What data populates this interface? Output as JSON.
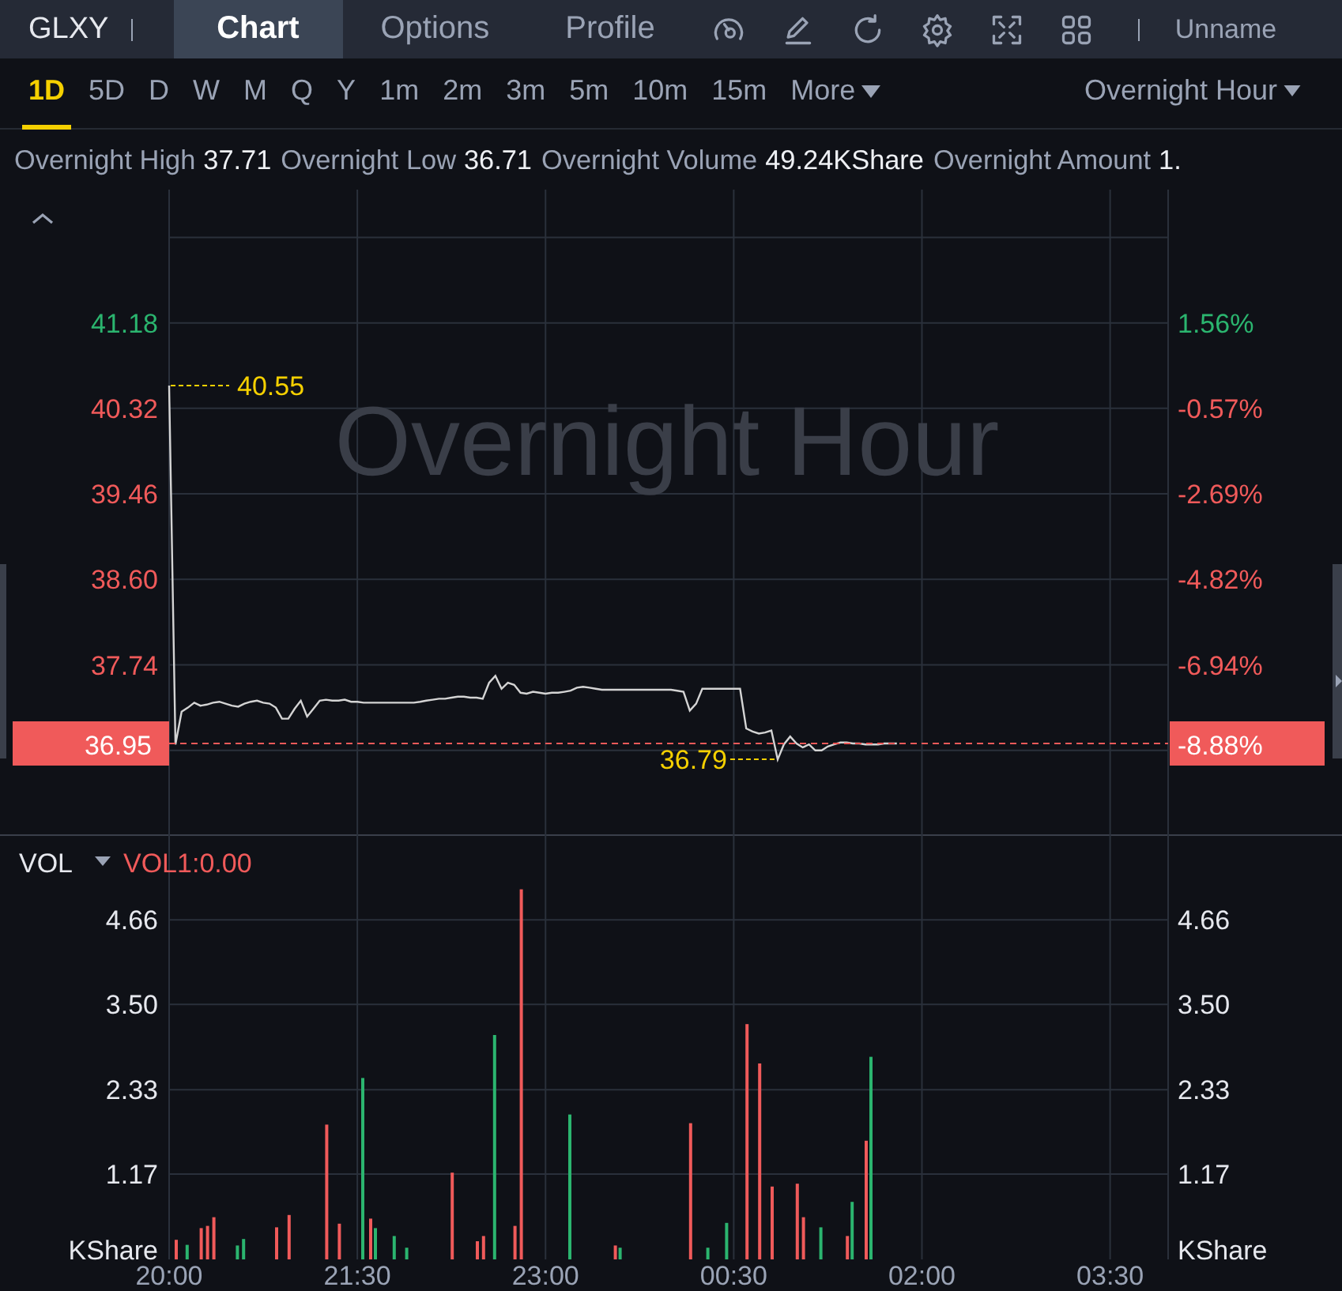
{
  "header": {
    "symbol": "GLXY",
    "tabs": [
      {
        "label": "Chart",
        "selected": true
      },
      {
        "label": "Options",
        "selected": false
      },
      {
        "label": "Profile",
        "selected": false
      }
    ],
    "user": "Unname"
  },
  "periods": {
    "items": [
      {
        "label": "1D",
        "selected": true,
        "kind": "period"
      },
      {
        "label": "5D",
        "selected": false,
        "kind": "period"
      },
      {
        "label": "D",
        "selected": false,
        "kind": "period"
      },
      {
        "label": "W",
        "selected": false,
        "kind": "period"
      },
      {
        "label": "M",
        "selected": false,
        "kind": "period"
      },
      {
        "label": "Q",
        "selected": false,
        "kind": "period"
      },
      {
        "label": "Y",
        "selected": false,
        "kind": "period"
      },
      {
        "label": "1m",
        "selected": false,
        "kind": "period"
      },
      {
        "label": "2m",
        "selected": false,
        "kind": "period"
      },
      {
        "label": "3m",
        "selected": false,
        "kind": "period"
      },
      {
        "label": "5m",
        "selected": false,
        "kind": "period"
      },
      {
        "label": "10m",
        "selected": false,
        "kind": "period"
      },
      {
        "label": "15m",
        "selected": false,
        "kind": "period"
      },
      {
        "label": "More",
        "selected": false,
        "kind": "dropdown"
      }
    ],
    "session": "Overnight Hour"
  },
  "stats": [
    {
      "label": "Overnight High",
      "value": "37.71"
    },
    {
      "label": "Overnight Low",
      "value": "36.71"
    },
    {
      "label": "Overnight Volume",
      "value": "49.24KShare"
    },
    {
      "label": "Overnight Amount",
      "value": "1."
    }
  ],
  "price_panel": {
    "background_label": "Overnight Hour",
    "axis_rows": [
      {
        "color": "#2bb56f",
        "right_label": "1.56%"
      },
      {
        "color": "#f05a5a",
        "right_label": "-0.57%"
      },
      {
        "color": "#f05a5a",
        "right_label": "-2.69%"
      },
      {
        "color": "#f05a5a",
        "right_label": "-4.82%"
      },
      {
        "color": "#f05a5a",
        "right_label": "-6.94%"
      }
    ],
    "last_price": {
      "change": "-8.88%"
    },
    "chart_data": {
      "type": "line",
      "series": [
        {
          "color": "#d4d4d4",
          "values": [
            40.55,
            36.94,
            37.27,
            37.31,
            37.36,
            37.33,
            37.34,
            37.36,
            37.37,
            37.35,
            37.33,
            37.32,
            37.35,
            37.37,
            37.38,
            37.36,
            37.35,
            37.31,
            37.2,
            37.2,
            37.3,
            37.38,
            37.22,
            37.3,
            37.38,
            37.39,
            37.38,
            37.38,
            37.39,
            37.37,
            37.37,
            37.36,
            37.36,
            37.36,
            37.36,
            37.36,
            37.36,
            37.36,
            37.36,
            37.36,
            37.37,
            37.38,
            37.39,
            37.4,
            37.4,
            37.41,
            37.42,
            37.42,
            37.41,
            37.41,
            37.4,
            37.56,
            37.63,
            37.5,
            37.56,
            37.54,
            37.46,
            37.45,
            37.47,
            37.46,
            37.45,
            37.46,
            37.46,
            37.47,
            37.48,
            37.51,
            37.52,
            37.51,
            37.5,
            37.49,
            37.49,
            37.49,
            37.49,
            37.49,
            37.49,
            37.49,
            37.49,
            37.49,
            37.49,
            37.49,
            37.49,
            37.48,
            37.47,
            37.28,
            37.35,
            37.5,
            37.5,
            37.5,
            37.5,
            37.5,
            37.5,
            37.5,
            37.1,
            37.07,
            37.05,
            37.06,
            37.08,
            36.79,
            36.94,
            37.02,
            36.95,
            36.91,
            36.94,
            36.88,
            36.88,
            36.92,
            36.94,
            36.96,
            36.96,
            36.95,
            36.95,
            36.94,
            36.94,
            36.94,
            36.95,
            36.95,
            36.95,
            null,
            null,
            null,
            null,
            null,
            null,
            null,
            null,
            null,
            null,
            null,
            null,
            null,
            null,
            null,
            null,
            null,
            null,
            null,
            null,
            null,
            null,
            null,
            null,
            null,
            null,
            null,
            null,
            null,
            null,
            null,
            null,
            null,
            null,
            null,
            null,
            null,
            null,
            null,
            null,
            null,
            null,
            null
          ]
        }
      ],
      "ylim": [
        36.036,
        42.52
      ],
      "grid": true,
      "ref_lines": [
        {
          "axis": "y",
          "value": 36.95,
          "label": "36.95",
          "color": "#f05a5a"
        }
      ],
      "yticks": [
        {
          "value": 41.18,
          "label": "41.18"
        },
        {
          "value": 40.32,
          "label": "40.32"
        },
        {
          "value": 39.46,
          "label": "39.46"
        },
        {
          "value": 38.6,
          "label": "38.60"
        },
        {
          "value": 37.74,
          "label": "37.74"
        }
      ],
      "annotations": [
        "40.55",
        "36.79"
      ]
    }
  },
  "volume_panel": {
    "indicator": "VOL",
    "indicator_value": "VOL1:0.00",
    "right_yticks": [
      "4.66",
      "3.50",
      "2.33",
      "1.17"
    ],
    "ylabel_right": "KShare",
    "chart_data": {
      "type": "bar",
      "ylabel": "KShare",
      "categories": [
        "20:00",
        null,
        null,
        null,
        null,
        null,
        null,
        null,
        null,
        null,
        null,
        null,
        null,
        null,
        null,
        null,
        null,
        null,
        null,
        null,
        null,
        null,
        null,
        null,
        null,
        null,
        null,
        null,
        null,
        null,
        "21:30",
        null,
        null,
        null,
        null,
        null,
        null,
        null,
        null,
        null,
        null,
        null,
        null,
        null,
        null,
        null,
        null,
        null,
        null,
        null,
        null,
        null,
        null,
        null,
        null,
        null,
        null,
        null,
        null,
        null,
        "23:00",
        null,
        null,
        null,
        null,
        null,
        null,
        null,
        null,
        null,
        null,
        null,
        null,
        null,
        null,
        null,
        null,
        null,
        null,
        null,
        null,
        null,
        null,
        null,
        null,
        null,
        null,
        null,
        null,
        null,
        "00:30",
        null,
        null,
        null,
        null,
        null,
        null,
        null,
        null,
        null,
        null,
        null,
        null,
        null,
        null,
        null,
        null,
        null,
        null,
        null,
        null,
        null,
        null,
        null,
        null,
        null,
        null,
        null,
        null,
        null,
        "02:00",
        null,
        null,
        null,
        null,
        null,
        null,
        null,
        null,
        null,
        null,
        null,
        null,
        null,
        null,
        null,
        null,
        null,
        null,
        null,
        null,
        null,
        null,
        null,
        null,
        null,
        null,
        null,
        null,
        null,
        "03:30",
        null,
        null,
        null,
        null,
        null,
        null,
        null,
        null,
        null
      ],
      "series": [
        {
          "color": "#2bb56f",
          "values": [
            null,
            null,
            null,
            0.2,
            null,
            null,
            null,
            null,
            null,
            null,
            null,
            0.19,
            0.28,
            null,
            null,
            null,
            null,
            null,
            null,
            null,
            null,
            null,
            null,
            null,
            null,
            null,
            null,
            null,
            null,
            null,
            null,
            2.49,
            null,
            0.43,
            null,
            null,
            0.32,
            null,
            0.16,
            null,
            null,
            null,
            null,
            null,
            null,
            null,
            null,
            null,
            null,
            null,
            null,
            null,
            3.08,
            null,
            null,
            null,
            null,
            null,
            null,
            null,
            null,
            null,
            null,
            null,
            1.99,
            null,
            null,
            null,
            null,
            null,
            null,
            null,
            0.16,
            null,
            null,
            null,
            null,
            null,
            null,
            null,
            null,
            null,
            null,
            null,
            null,
            null,
            0.16,
            null,
            null,
            0.5,
            null,
            null,
            null,
            null,
            null,
            null,
            null,
            null,
            null,
            null,
            null,
            null,
            null,
            null,
            0.44,
            null,
            null,
            null,
            null,
            0.79,
            null,
            null,
            2.78,
            null,
            null,
            null,
            null,
            null,
            null,
            null,
            null,
            null,
            null,
            null,
            null,
            null,
            null,
            null,
            null,
            null,
            null,
            null,
            null,
            null,
            null,
            null,
            null,
            null,
            null,
            null,
            null,
            null,
            null,
            null,
            null,
            null,
            null,
            null,
            null,
            null,
            null,
            null,
            null,
            null,
            null,
            null,
            null,
            null,
            null,
            null
          ]
        },
        {
          "color": "#f05a5a",
          "values": [
            null,
            0.27,
            null,
            null,
            null,
            0.43,
            0.46,
            0.58,
            null,
            null,
            null,
            null,
            null,
            null,
            null,
            null,
            null,
            0.44,
            null,
            0.61,
            null,
            null,
            null,
            null,
            null,
            1.85,
            null,
            0.49,
            null,
            null,
            null,
            null,
            0.56,
            null,
            null,
            null,
            null,
            null,
            null,
            null,
            null,
            null,
            null,
            null,
            null,
            1.19,
            null,
            null,
            null,
            0.25,
            0.32,
            null,
            null,
            null,
            null,
            0.46,
            5.08,
            null,
            null,
            null,
            null,
            null,
            null,
            null,
            null,
            null,
            null,
            null,
            null,
            null,
            null,
            0.19,
            null,
            null,
            null,
            null,
            null,
            null,
            null,
            null,
            null,
            null,
            null,
            1.87,
            null,
            null,
            null,
            null,
            null,
            null,
            null,
            null,
            3.23,
            null,
            2.69,
            null,
            1.0,
            null,
            null,
            null,
            1.04,
            0.58,
            null,
            null,
            null,
            null,
            null,
            null,
            0.32,
            null,
            null,
            1.63,
            null,
            null,
            null,
            null,
            null,
            null,
            null,
            null,
            null,
            null,
            null,
            null,
            null,
            null,
            null,
            null,
            null,
            null,
            null,
            null,
            null,
            null,
            null,
            null,
            null,
            null,
            null,
            null,
            null,
            null,
            null,
            null,
            null,
            null,
            null,
            null,
            null,
            null,
            null,
            null,
            null,
            null,
            null,
            null,
            null,
            null,
            null,
            null
          ]
        }
      ],
      "stacked": false,
      "grid": true,
      "ylim": [
        0,
        5.835
      ],
      "yticks": [
        {
          "value": 4.66,
          "label": "4.66"
        },
        {
          "value": 3.5,
          "label": "3.50"
        },
        {
          "value": 2.33,
          "label": "2.33"
        },
        {
          "value": 1.17,
          "label": "1.17"
        }
      ]
    }
  }
}
